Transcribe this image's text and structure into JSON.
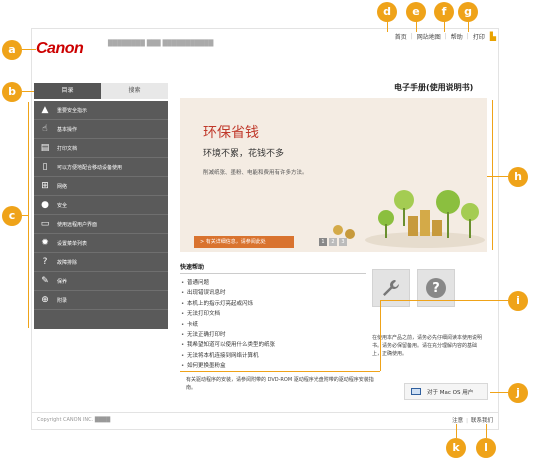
{
  "header": {
    "logo": "Canon",
    "model": "████████ ███ ███████████",
    "nav": [
      "首页",
      "网站地图",
      "帮助",
      "打印"
    ]
  },
  "tabs": [
    "目录",
    "搜索"
  ],
  "sidebar": {
    "items": [
      {
        "label": "重要安全指示",
        "icon": "warning-icon"
      },
      {
        "label": "基本操作",
        "icon": "hand-icon"
      },
      {
        "label": "打印文档",
        "icon": "printer-icon"
      },
      {
        "label": "可以方便地配合移动设备使用",
        "icon": "mobile-icon"
      },
      {
        "label": "网络",
        "icon": "network-icon"
      },
      {
        "label": "安全",
        "icon": "lock-icon"
      },
      {
        "label": "使用远程用户界面",
        "icon": "remote-ui-icon"
      },
      {
        "label": "设置菜单列表",
        "icon": "gear-icon"
      },
      {
        "label": "故障排除",
        "icon": "question-icon"
      },
      {
        "label": "保养",
        "icon": "wrench-icon"
      },
      {
        "label": "附录",
        "icon": "plus-icon"
      }
    ]
  },
  "main": {
    "doc_title": "电子手册(使用说明书)",
    "hero": {
      "title": "环保省钱",
      "subtitle": "环境不累，花钱不多",
      "desc": "削减纸张、墨粉、电能和费用有许多方法。",
      "link": "> 有关详细信息，请参阅此处",
      "pages": [
        "1",
        "2",
        "3"
      ]
    },
    "quick": {
      "title": "快速帮助",
      "items": [
        "普通问题",
        "出现错误讯息时",
        "本机上的指示灯亮起或闪烁",
        "无法打印文档",
        "卡纸",
        "无法正确打印时",
        "我希望知道可以使用什么类型的纸张",
        "无法将本机连接到网络计算机",
        "如何更换墨粉盒"
      ]
    },
    "note": "在使用本产品之前，请务必先仔细阅读本使用说明书。请务必保留备用。请在充分理解内容的基础上，正确使用。",
    "cd_note": "有关驱动程序的安装，请参阅附带的 DVD-ROM 驱动程序光盘附带的驱动程序安装指南。",
    "mac_button": "对于 Mac OS 用户"
  },
  "footer": {
    "copyright": "Copyright CANON INC. ████",
    "links": [
      "注意",
      "联系我们"
    ]
  },
  "callouts": [
    "a",
    "b",
    "c",
    "d",
    "e",
    "f",
    "g",
    "h",
    "i",
    "j",
    "k",
    "l"
  ],
  "colors": {
    "accent": "#efa319",
    "brand": "#cc0000",
    "sidebar": "#5a5a5a",
    "link_button": "#d9732f"
  }
}
